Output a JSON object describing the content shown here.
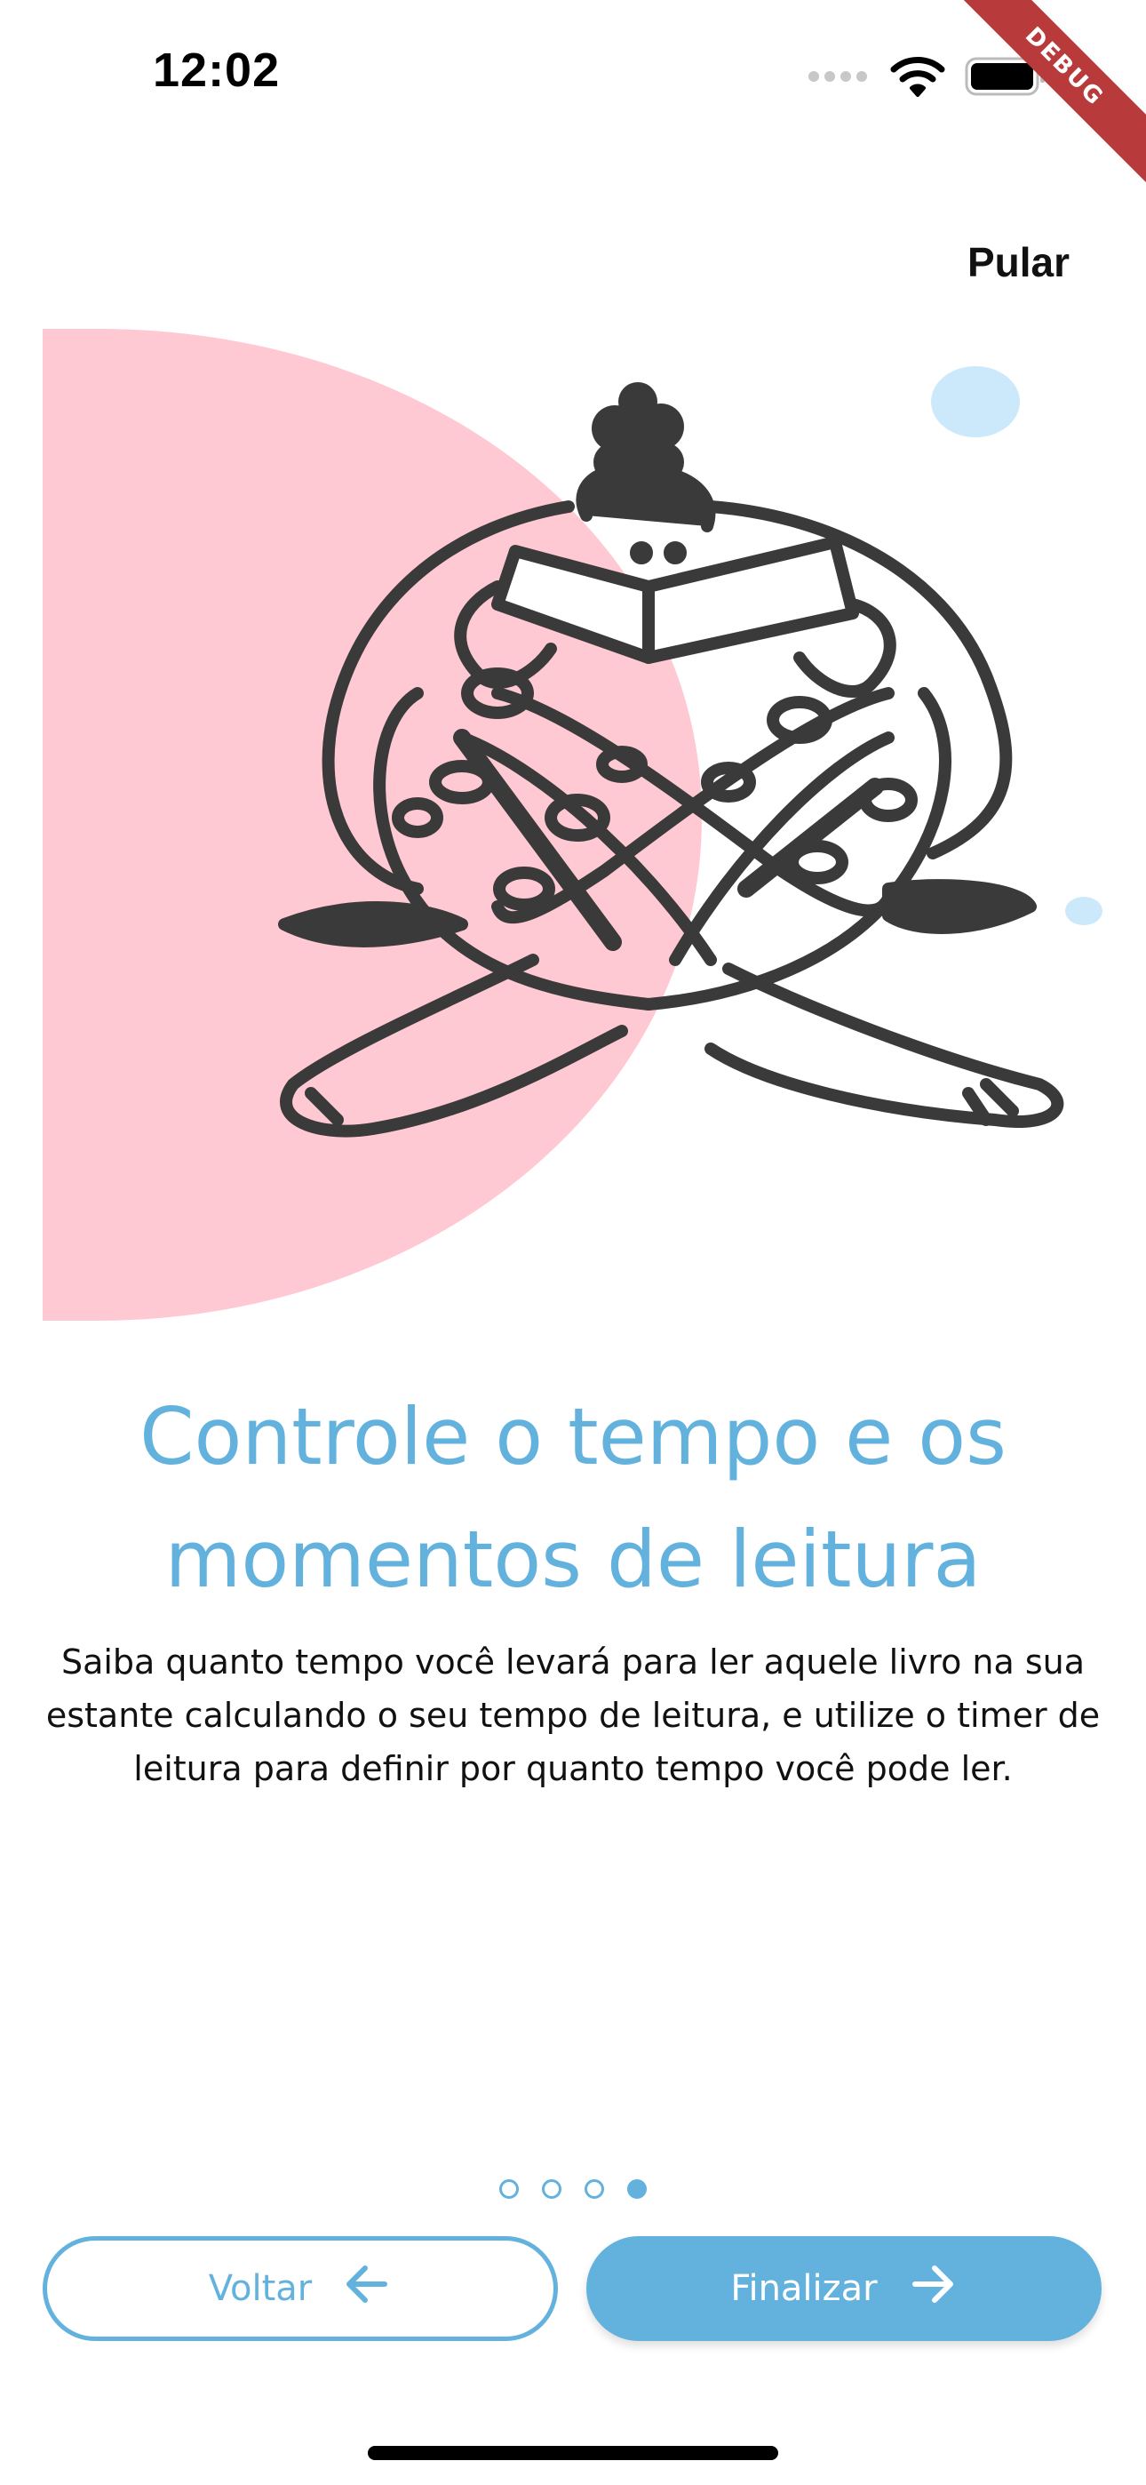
{
  "status_bar": {
    "time": "12:02",
    "icons": [
      "signal-dots-icon",
      "wifi-icon",
      "battery-icon"
    ],
    "debug_label": "DEBUG"
  },
  "header": {
    "skip_label": "Pular"
  },
  "onboarding": {
    "title": "Controle o tempo e os momentos de leitura",
    "description": "Saiba quanto tempo você levará para ler aquele livro na sua estante calculando o seu tempo de leitura, e utilize o timer de leitura para definir por quanto tempo você pode ler.",
    "page_indicator": {
      "total": 4,
      "current": 4
    }
  },
  "footer": {
    "back_label": "Voltar",
    "finish_label": "Finalizar"
  },
  "colors": {
    "accent": "#63b2dd",
    "pink_blob": "#ffc9d4",
    "light_blue_blob": "#cce9fb",
    "ink": "#3a3a3a"
  }
}
